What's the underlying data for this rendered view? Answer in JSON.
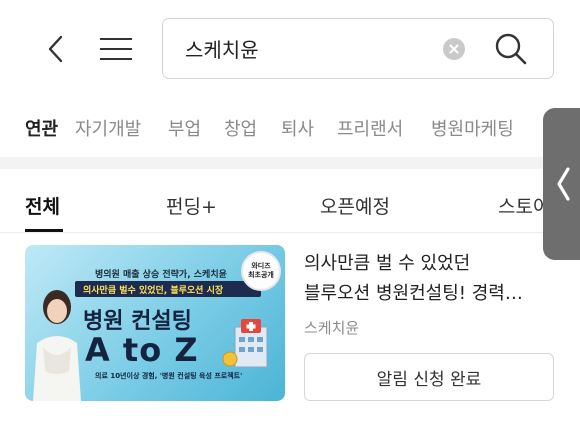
{
  "search": {
    "query": "스케치윤"
  },
  "related": {
    "label": "연관",
    "keywords": [
      "자기개발",
      "부업",
      "창업",
      "퇴사",
      "프리랜서",
      "병원마케팅"
    ]
  },
  "tabs": [
    "전체",
    "펀딩+",
    "오픈예정",
    "스토어"
  ],
  "card": {
    "thumbnail": {
      "top_text": "병의원 매출 상승 전략가, 스케치윤",
      "band_text": "의사만큼 벌수 있었던, 블루오션 시장",
      "title": "병원 컨설팅",
      "big": "A to Z",
      "seal_line1": "와디즈",
      "seal_line2": "최초공개",
      "bottom_text": "의료 10년이상 경험, '병원 컨설팅 육성 프로젝트'"
    },
    "title_line1": "의사만큼 벌 수 있었던",
    "title_line2": "블루오션 병원컨설팅! 경력…",
    "maker": "스케치윤",
    "button_label": "알림 신청 완료"
  },
  "colors": {
    "accent_dark": "#111111",
    "muted_text": "#8a8a8a",
    "handle": "#6e6e6e"
  },
  "icons": [
    "back-arrow-icon",
    "hamburger-menu-icon",
    "clear-icon",
    "search-icon",
    "chevron-left-icon"
  ]
}
